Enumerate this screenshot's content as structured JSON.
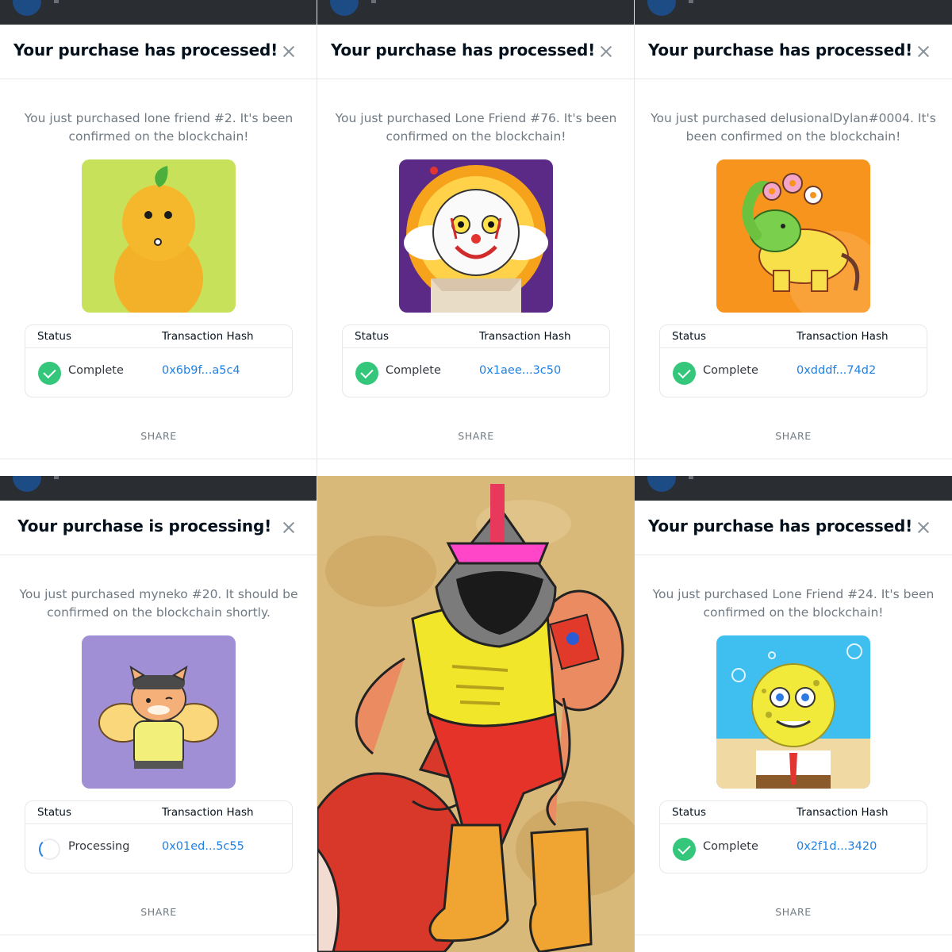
{
  "common": {
    "status_header": "Status",
    "hash_header": "Transaction Hash",
    "share_label": "SHARE"
  },
  "cards": [
    {
      "title": "Your purchase has processed!",
      "message": "You just purchased lone friend #2. It's been confirmed on the blockchain!",
      "status": "Complete",
      "hash": "0x6b9f...a5c4",
      "art": "yellow-pear-creature"
    },
    {
      "title": "Your purchase has processed!",
      "message": "You just purchased Lone Friend #76. It's been confirmed on the blockchain!",
      "status": "Complete",
      "hash": "0x1aee...3c50",
      "art": "clown-character"
    },
    {
      "title": "Your purchase has processed!",
      "message": "You just purchased delusionalDylan#0004. It's been confirmed on the blockchain!",
      "status": "Complete",
      "hash": "0xdddf...74d2",
      "art": "green-elephant-donuts"
    },
    {
      "title": "Your purchase is processing!",
      "message": "You just purchased myneko #20. It should be confirmed on the blockchain shortly.",
      "status": "Processing",
      "hash": "0x01ed...5c55",
      "art": "hamster-cat-wings"
    },
    {
      "title": "Your purchase has processed!",
      "message": "You just purchased Lone Friend #24. It's been confirmed on the blockchain!",
      "status": "Complete",
      "hash": "0x2f1d...3420",
      "art": "sponge-character"
    }
  ],
  "artwork": {
    "subject": "knight-wrestler-with-fox",
    "colors": {
      "background": "#d9b979",
      "shirt": "#f1e62a",
      "pants": "#e5332a",
      "boots": "#f0a532",
      "skin": "#eb8b62",
      "fox": "#d8382a",
      "helmet": "#7b7b7b",
      "visor": "#ff46c8"
    }
  },
  "theme": {
    "accent": "#2081e2",
    "success": "#34c77b",
    "title_color": "#04111d",
    "muted": "#707a83"
  }
}
